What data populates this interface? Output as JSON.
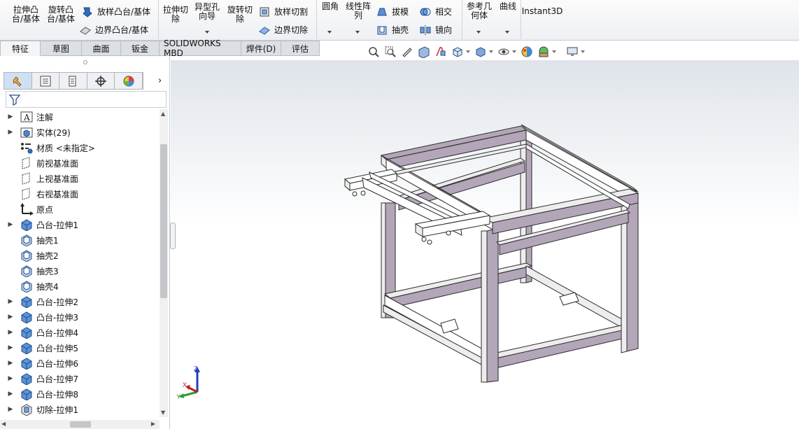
{
  "ribbon": {
    "buttons": [
      {
        "id": "extrude_boss",
        "label": "拉伸凸\n台/基体"
      },
      {
        "id": "revolve_boss",
        "label": "旋转凸\n台/基体"
      },
      {
        "id": "extrude_cut",
        "label": "拉伸切\n除"
      },
      {
        "id": "hole_wizard",
        "label": "异型孔\n向导"
      },
      {
        "id": "revolve_cut",
        "label": "旋转切\n除"
      },
      {
        "id": "fillet",
        "label": "圆角"
      },
      {
        "id": "linear_pattern",
        "label": "线性阵\n列"
      },
      {
        "id": "reference_geometry",
        "label": "参考几\n何体"
      },
      {
        "id": "curves",
        "label": "曲线"
      },
      {
        "id": "instant3d",
        "label": "Instant3D"
      }
    ],
    "small": {
      "swept_boss": "放样凸台/基体",
      "boundary_boss": "边界凸台/基体",
      "swept_cut": "放样切割",
      "boundary_cut": "边界切除",
      "draft": "拔模",
      "shell": "抽壳",
      "intersect": "相交",
      "mirror": "镜向"
    }
  },
  "tabs": [
    "特征",
    "草图",
    "曲面",
    "钣金",
    "SOLIDWORKS MBD",
    "焊件(D)",
    "评估"
  ],
  "active_tab": 0,
  "tree": [
    {
      "label": "注解",
      "expandable": true,
      "icon": "annotation-icon"
    },
    {
      "label": "实体(29)",
      "expandable": true,
      "icon": "solid-bodies-icon"
    },
    {
      "label": "材质 <未指定>",
      "expandable": false,
      "icon": "material-icon"
    },
    {
      "label": "前视基准面",
      "expandable": false,
      "icon": "plane-icon"
    },
    {
      "label": "上视基准面",
      "expandable": false,
      "icon": "plane-icon"
    },
    {
      "label": "右视基准面",
      "expandable": false,
      "icon": "plane-icon"
    },
    {
      "label": "原点",
      "expandable": false,
      "icon": "origin-icon"
    },
    {
      "label": "凸台-拉伸1",
      "expandable": true,
      "icon": "extrude-icon"
    },
    {
      "label": "抽壳1",
      "expandable": false,
      "icon": "shell-icon"
    },
    {
      "label": "抽壳2",
      "expandable": false,
      "icon": "shell-icon"
    },
    {
      "label": "抽壳3",
      "expandable": false,
      "icon": "shell-icon"
    },
    {
      "label": "抽壳4",
      "expandable": false,
      "icon": "shell-icon"
    },
    {
      "label": "凸台-拉伸2",
      "expandable": true,
      "icon": "extrude-icon"
    },
    {
      "label": "凸台-拉伸3",
      "expandable": true,
      "icon": "extrude-icon"
    },
    {
      "label": "凸台-拉伸4",
      "expandable": true,
      "icon": "extrude-icon"
    },
    {
      "label": "凸台-拉伸5",
      "expandable": true,
      "icon": "extrude-icon"
    },
    {
      "label": "凸台-拉伸6",
      "expandable": true,
      "icon": "extrude-icon"
    },
    {
      "label": "凸台-拉伸7",
      "expandable": true,
      "icon": "extrude-icon"
    },
    {
      "label": "凸台-拉伸8",
      "expandable": true,
      "icon": "extrude-icon"
    },
    {
      "label": "切除-拉伸1",
      "expandable": true,
      "icon": "cut-extrude-icon"
    }
  ],
  "triad": {
    "x": "X",
    "y": "Y",
    "z": "Z"
  },
  "colors": {
    "frame_light": "#eeeeee",
    "frame_purple": "#b3a6b8",
    "accent_blue": "#1f5fbf"
  }
}
